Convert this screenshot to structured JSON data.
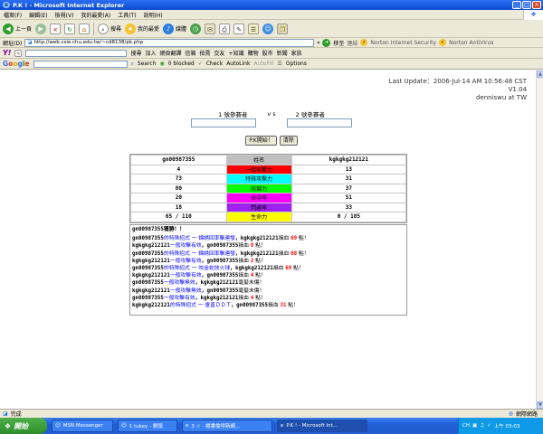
{
  "window": {
    "title": "P.K ! - Microsoft Internet Explorer"
  },
  "menu": [
    "檔案(F)",
    "編輯(E)",
    "檢視(V)",
    "我的最愛(A)",
    "工具(T)",
    "說明(H)"
  ],
  "toolbar": {
    "back": "上一頁",
    "search": "搜尋",
    "favorites": "我的最愛",
    "media": "媒體",
    "go": "移至",
    "links": "連結",
    "norton_security": "Norton Internet Security",
    "norton_antivirus": "Norton AntiVirus"
  },
  "address": {
    "label": "網址(D)",
    "url": "http://web.csie.chu.edu.tw/~cd8138/pk.php"
  },
  "yahoo_bar": {
    "search": "搜尋",
    "join": "加入",
    "items": [
      "網頁翻譯",
      "信箱",
      "拍賣",
      "交友",
      "+知識",
      "購物",
      "股市",
      "新聞",
      "家族"
    ]
  },
  "google_bar": {
    "logo": "Google",
    "search": "Search",
    "blocked": "0 blocked",
    "check": "Check",
    "autolink": "AutoLink",
    "autofill": "AutoFill",
    "options": "Options"
  },
  "page": {
    "last_update": "Last Update：2006-Jul-14    AM 10:56:48 CST",
    "version": "V1.04",
    "author": "denniswu at TW",
    "player1_label": "1 號參賽者",
    "vs": "v s",
    "player2_label": "2 號參賽者",
    "pk_button": "P.K開始！",
    "clear_button": "清除",
    "stats_header": {
      "left": "gn00987355",
      "mid": "姓名",
      "right": "kgkgkg212121"
    },
    "stats": [
      {
        "left": "4",
        "label": "一般攻擊力",
        "right": "13",
        "color": "#ff0000"
      },
      {
        "left": "73",
        "label": "特殊攻擊力",
        "right": "31",
        "color": "#00ffff"
      },
      {
        "left": "80",
        "label": "防禦力",
        "right": "37",
        "color": "#00ff00"
      },
      {
        "left": "20",
        "label": "命中率",
        "right": "51",
        "color": "#ff00ff"
      },
      {
        "left": "18",
        "label": "閃避率",
        "right": "33",
        "color": "#a020f0"
      },
      {
        "left": "65  /  110",
        "label": "生命力",
        "right": "0  /  185",
        "color": "#ffff00"
      }
    ],
    "log_first": "gn00987355獲勝！！",
    "log": [
      [
        "gn00987355",
        "的特殊招式 一 錦綉回率擊連發",
        "，kgkgkg212121",
        "損血 ",
        "69",
        " 點！"
      ],
      [
        "kgkgkg212121",
        "一般攻擊有效",
        "，gn00987355",
        "損血 ",
        "8",
        " 點！"
      ],
      [
        "gn00987355",
        "的特殊招式 一 錦綉回率擊連發",
        "，kgkgkg212121",
        "損血 ",
        "68",
        " 點！"
      ],
      [
        "kgkgkg212121",
        "一般攻擊有效",
        "，gn00987355",
        "損血 ",
        "2",
        " 點！"
      ],
      [
        "gn00987355",
        "的特殊招式 一 咬金蛇放火球",
        "，kgkgkg212121",
        "損血 ",
        "69",
        " 點！"
      ],
      [
        "kgkgkg212121",
        "一般攻擊有效",
        "，gn00987355",
        "損血 ",
        "4",
        " 點！"
      ],
      [
        "gn00987355",
        "一般攻擊無效",
        "，kgkgkg212121",
        "毫髮未傷！",
        "",
        ""
      ],
      [
        "kgkgkg212121",
        "一般攻擊無效",
        "，gn00987355",
        "毫髮未傷！",
        "",
        ""
      ],
      [
        "gn00987355",
        "一般攻擊有效",
        "，kgkgkg212121",
        "損血 ",
        "4",
        " 點！"
      ],
      [
        "kgkgkg212121",
        "的特殊招式 一 垂直ＤＤＴ",
        "，gn00987355",
        "損血 ",
        "31",
        " 點！"
      ]
    ]
  },
  "status": {
    "text": "完成",
    "zone": "網際網路"
  },
  "taskbar": {
    "start": "開始",
    "tasks": [
      "MSN Messenger",
      "1 tukey - 剩頭",
      "3 ☆ - 楊書倫得新網...",
      "P.K ! - Microsoft Int..."
    ],
    "lang": "CH",
    "clock": "上午 03:03"
  },
  "colors": {
    "title_bar": "#0a4bd0",
    "chrome": "#ece9d8",
    "taskbar": "#225bd1",
    "start": "#2e8d2a"
  }
}
